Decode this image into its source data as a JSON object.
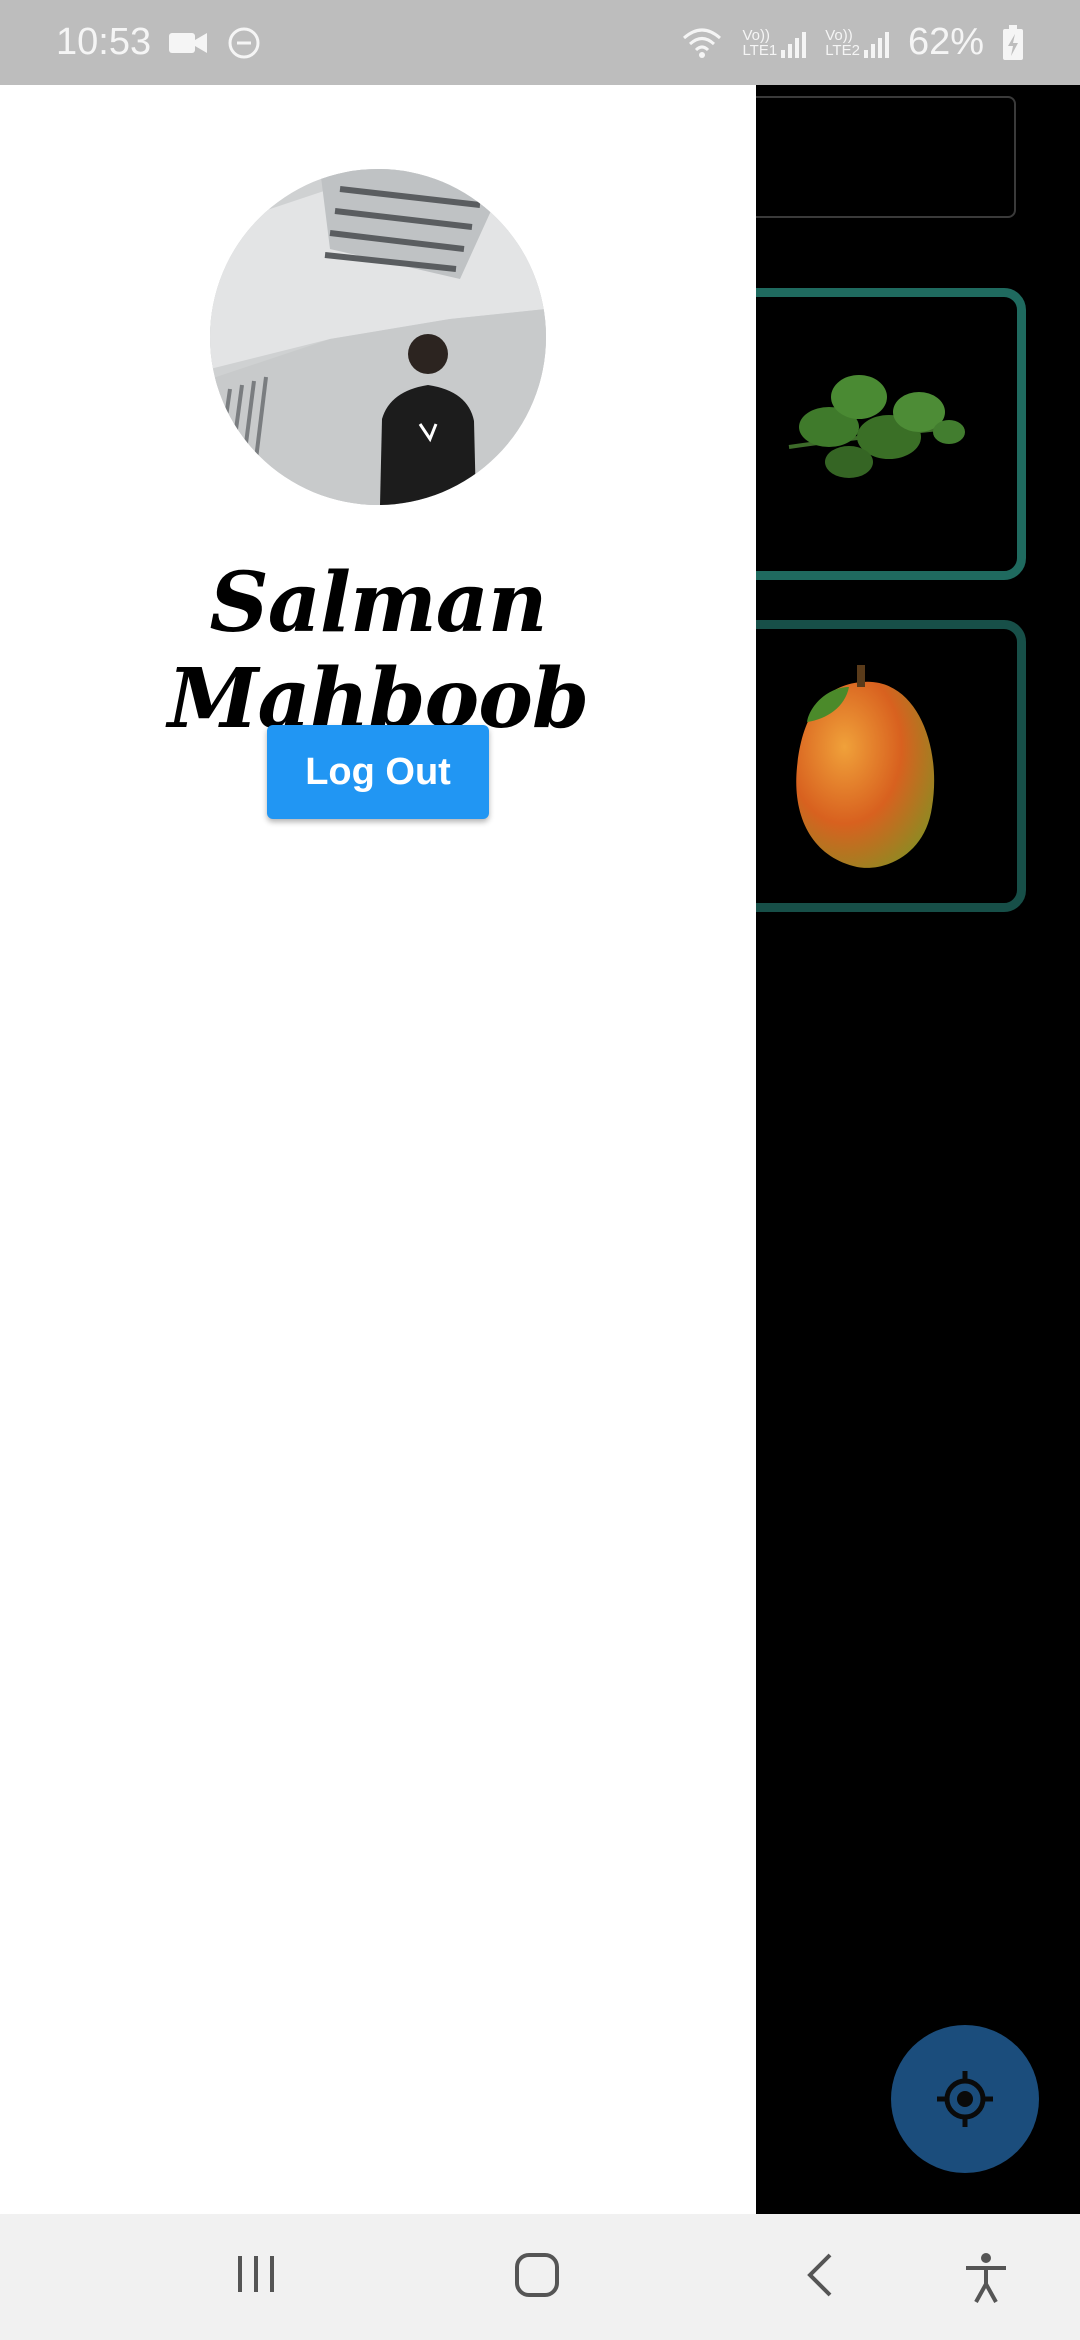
{
  "status_bar": {
    "time": "10:53",
    "left_icons": [
      "video-camera-icon",
      "do-not-disturb-icon"
    ],
    "right_icons": [
      "wifi-icon",
      "signal-lte1-icon",
      "signal-lte2-icon",
      "battery-charging-icon"
    ],
    "lte1_label": "LTE1",
    "lte2_label": "LTE2",
    "volte_label": "Vo))",
    "battery": "62%"
  },
  "drawer": {
    "user_name": "Salman Mahboob",
    "logout_label": "Log Out",
    "logout_color": "#2196f3"
  },
  "background": {
    "cards": [
      {
        "icon": "parsley-leaf-icon"
      },
      {
        "icon": "mango-icon"
      }
    ],
    "fab_icon": "gps-crosshair-icon",
    "accent": "#1f6a5f"
  },
  "nav_bar": {
    "buttons": [
      "recents-icon",
      "home-icon",
      "back-icon",
      "accessibility-icon"
    ]
  }
}
